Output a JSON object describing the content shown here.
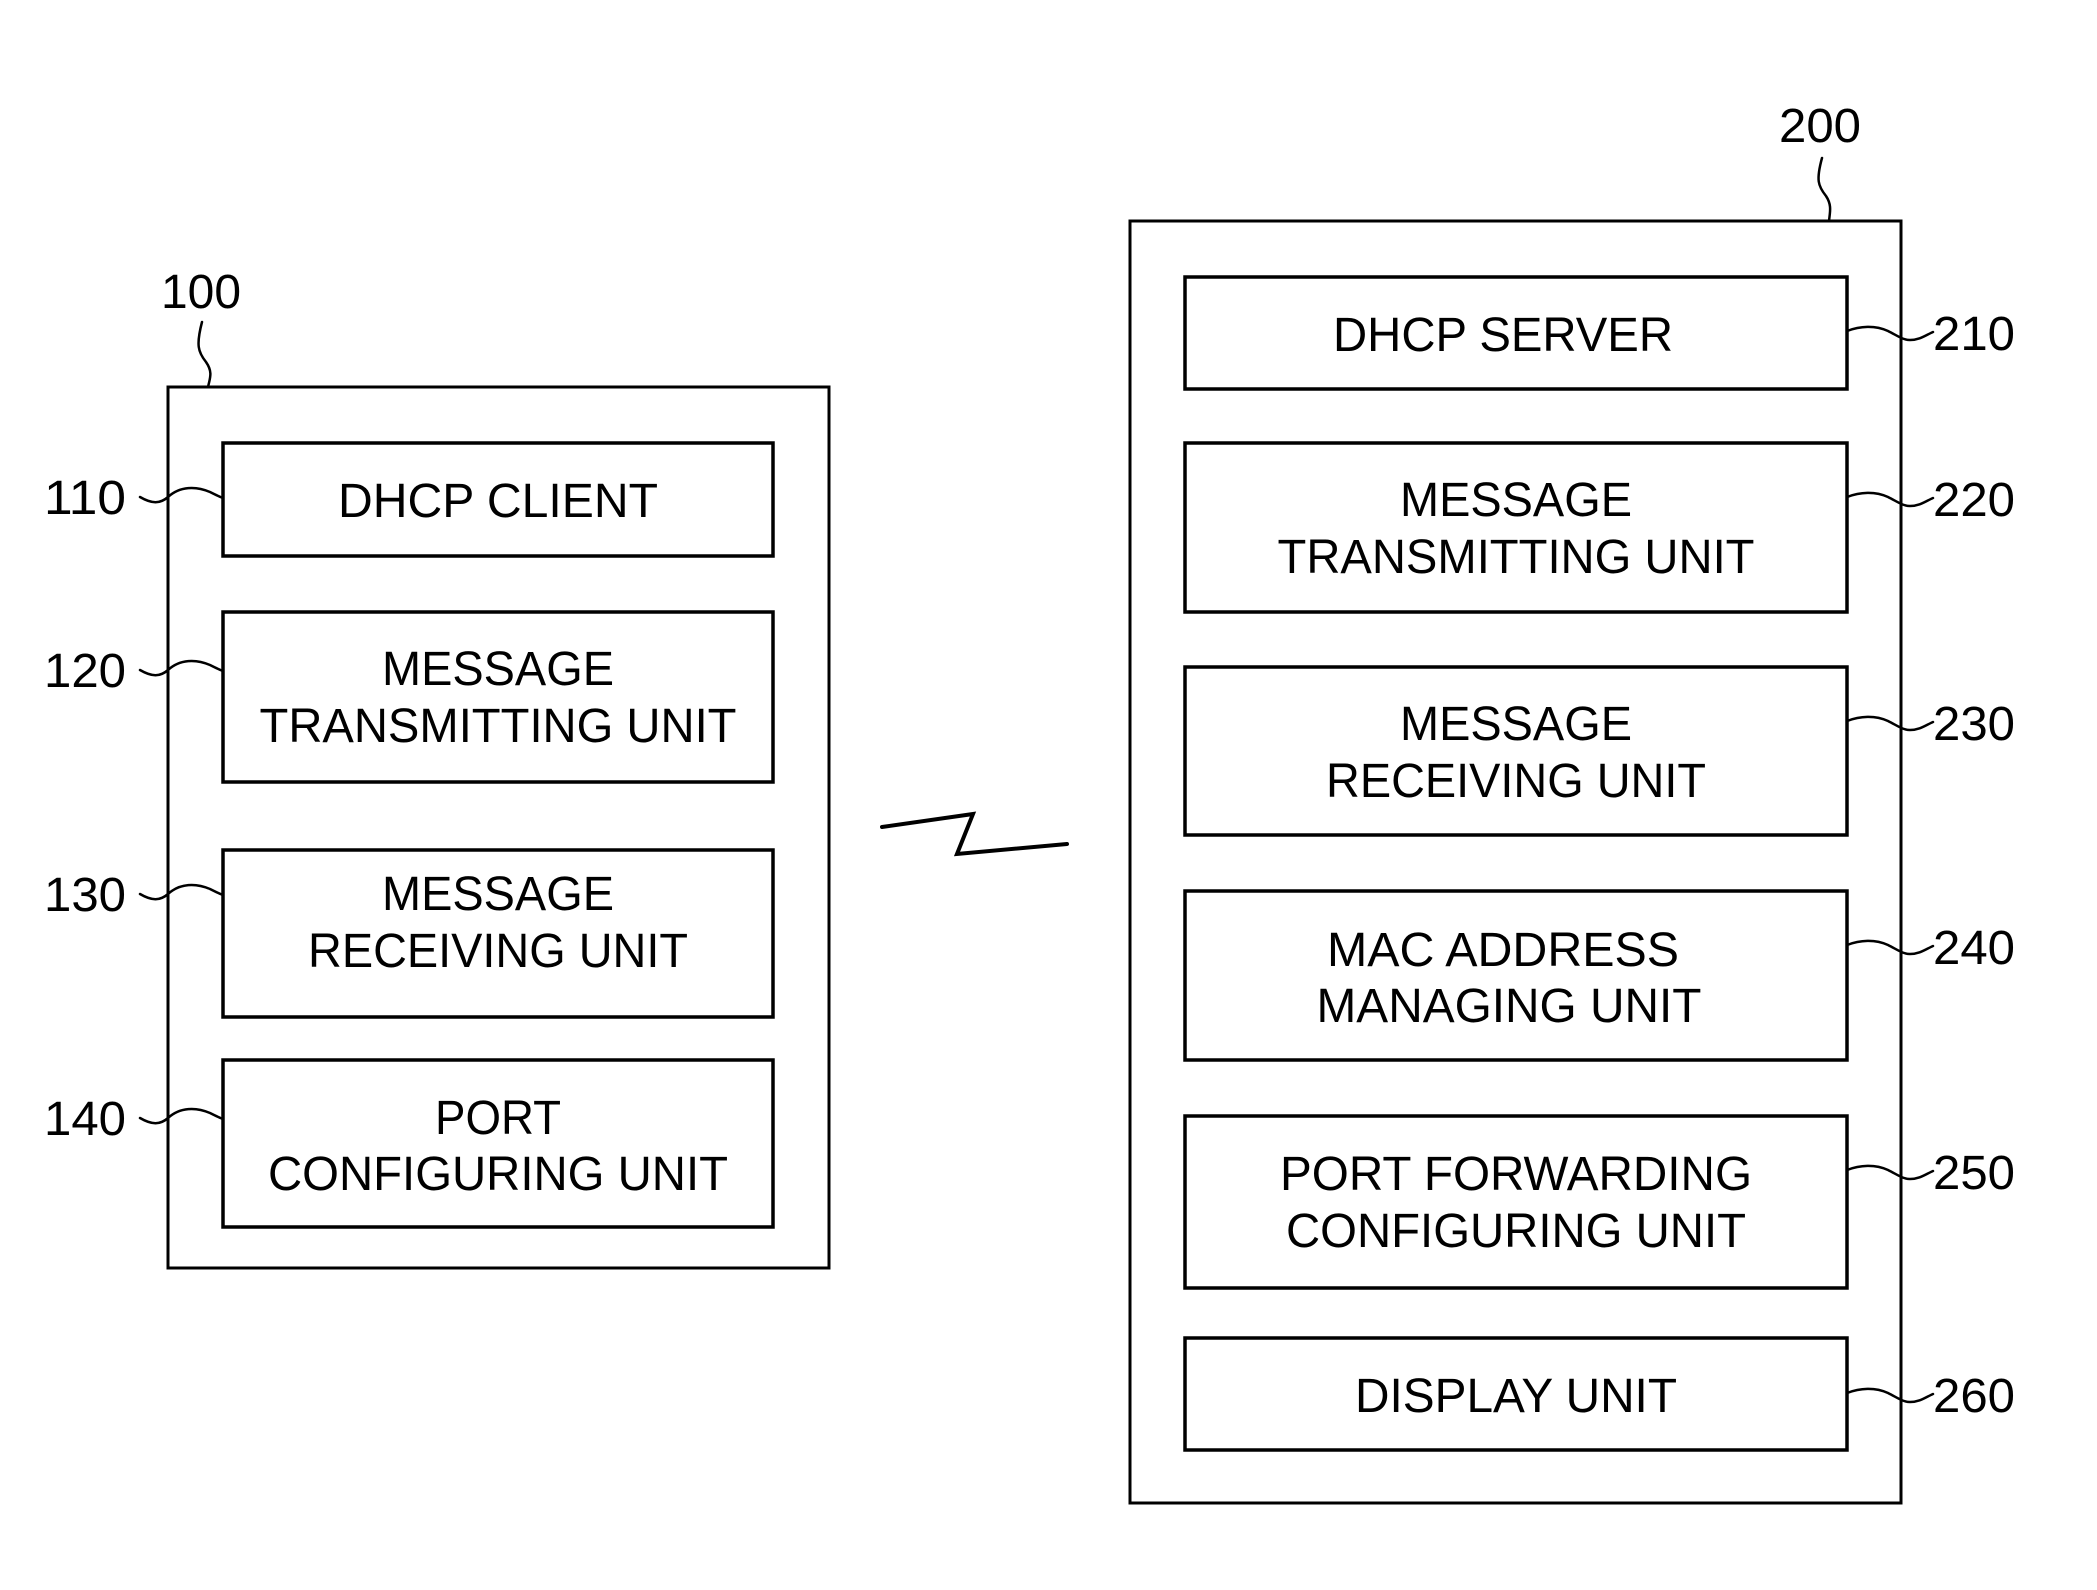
{
  "figure": {
    "client_device": {
      "ref": "100",
      "units": [
        {
          "ref": "110",
          "lines": [
            "DHCP CLIENT"
          ]
        },
        {
          "ref": "120",
          "lines": [
            "MESSAGE",
            "TRANSMITTING UNIT"
          ]
        },
        {
          "ref": "130",
          "lines": [
            "MESSAGE",
            "RECEIVING UNIT"
          ]
        },
        {
          "ref": "140",
          "lines": [
            "PORT",
            "CONFIGURING UNIT"
          ]
        }
      ]
    },
    "link": {
      "icon": "wireless-link-bolt-icon"
    },
    "server_device": {
      "ref": "200",
      "units": [
        {
          "ref": "210",
          "lines": [
            "DHCP SERVER"
          ]
        },
        {
          "ref": "220",
          "lines": [
            "MESSAGE",
            "TRANSMITTING UNIT"
          ]
        },
        {
          "ref": "230",
          "lines": [
            "MESSAGE",
            "RECEIVING UNIT"
          ]
        },
        {
          "ref": "240",
          "lines": [
            "MAC ADDRESS",
            "MANAGING UNIT"
          ]
        },
        {
          "ref": "250",
          "lines": [
            "PORT FORWARDING",
            "CONFIGURING UNIT"
          ]
        },
        {
          "ref": "260",
          "lines": [
            "DISPLAY UNIT"
          ]
        }
      ]
    }
  }
}
